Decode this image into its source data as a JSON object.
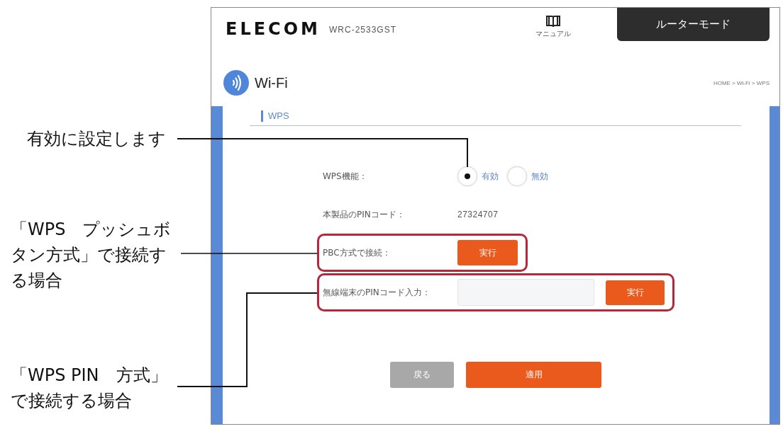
{
  "header": {
    "logo": "ELECOM",
    "model": "WRC-2533GST",
    "manual_link": "マニュアル",
    "mode_button": "ルーターモード"
  },
  "page_title": {
    "title": "Wi-Fi",
    "breadcrumb": "HOME > Wi-Fi > WPS"
  },
  "section": {
    "heading": "WPS"
  },
  "form": {
    "rows": [
      {
        "kind": "radio",
        "label": "WPS機能：",
        "highlighted": false,
        "options": [
          {
            "label": "有効",
            "selected": true
          },
          {
            "label": "無効",
            "selected": false
          }
        ]
      },
      {
        "kind": "value",
        "label": "本製品のPINコード：",
        "value": "27324707",
        "highlighted": false
      },
      {
        "kind": "button",
        "label": "PBC方式で接続：",
        "button": "実行",
        "highlighted": true
      },
      {
        "kind": "input",
        "label": "無線端末のPINコード入力：",
        "button": "実行",
        "highlighted": true
      }
    ]
  },
  "buttons": [
    {
      "label": "戻る",
      "kind": "secondary"
    },
    {
      "label": "適用",
      "kind": "primary"
    }
  ],
  "annotations": [
    {
      "text": "有効に設定します"
    },
    {
      "text": "「WPS　プッシュボタン方式」で接続する場合"
    },
    {
      "text": "「WPS PIN　方式」で接続する場合"
    }
  ]
}
